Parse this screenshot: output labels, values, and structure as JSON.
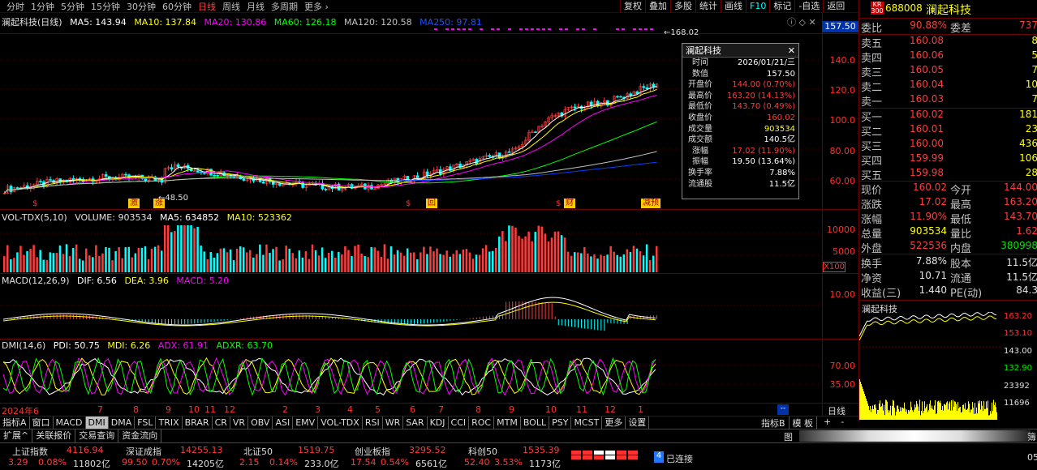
{
  "periods": [
    "分时",
    "1分钟",
    "5分钟",
    "15分钟",
    "30分钟",
    "60分钟",
    "日线",
    "周线",
    "月线",
    "多周期",
    "更多"
  ],
  "active_period": "日线",
  "toolbar": [
    "复权",
    "叠加",
    "多股",
    "统计",
    "画线",
    "F10",
    "标记",
    "-自选",
    "返回"
  ],
  "main_legend": {
    "name": "澜起科技(日线)",
    "ma5": "MA5: 143.94",
    "ma10": "MA10: 137.84",
    "ma20": "MA20: 130.86",
    "ma60": "MA60: 126.18",
    "ma120": "MA120: 120.58",
    "ma250": "MA250: 97.81"
  },
  "main_axis": [
    "140.0",
    "120.0",
    "100.0",
    "80.00",
    "60.00"
  ],
  "price_tag": "157.50",
  "high_mark": "168.02",
  "low_mark": "48.50",
  "markers": [
    "涨",
    "回",
    "财",
    "减预",
    "激",
    "涨"
  ],
  "vol_legend": {
    "name": "VOL-TDX(5,10)",
    "volume": "VOLUME: 903534",
    "ma5": "MA5: 634852",
    "ma10": "MA10: 523362"
  },
  "vol_axis": [
    "10000",
    "5000"
  ],
  "vol_unit": "X100",
  "macd_legend": {
    "name": "MACD(12,26,9)",
    "dif": "DIF: 6.56",
    "dea": "DEA: 3.96",
    "macd": "MACD: 5.20"
  },
  "macd_axis": [
    "10.00"
  ],
  "dmi_legend": {
    "name": "DMI(14,6)",
    "pdi": "PDI: 50.75",
    "mdi": "MDI: 6.26",
    "adx": "ADX: 61.91",
    "adxr": "ADXR: 63.70"
  },
  "dmi_axis": [
    "70.00",
    "35.00"
  ],
  "date_axis": [
    "2024年6",
    "7",
    "8",
    "9",
    "10",
    "11",
    "12",
    "2",
    "3",
    "4",
    "5",
    "6",
    "7",
    "8",
    "9",
    "10",
    "11",
    "12",
    "1"
  ],
  "date_right": "日线",
  "tooltip": {
    "title": "澜起科技",
    "rows": [
      [
        "时间",
        "2026/01/21/三"
      ],
      [
        "数值",
        "157.50"
      ],
      [
        "开盘价",
        "144.00 (0.70%)"
      ],
      [
        "最高价",
        "163.20 (14.13%)"
      ],
      [
        "最低价",
        "143.70 (0.49%)"
      ],
      [
        "收盘价",
        "160.02"
      ],
      [
        "成交量",
        "903534"
      ],
      [
        "成交额",
        "140.5亿"
      ],
      [
        "涨幅",
        "17.02 (11.90%)"
      ],
      [
        "振幅",
        "19.50 (13.64%)"
      ],
      [
        "换手率",
        "7.88%"
      ],
      [
        "流通股",
        "11.5亿"
      ]
    ]
  },
  "stock": {
    "badge": "KR",
    "badge_sub": "300",
    "code": "688008",
    "name": "澜起科技"
  },
  "webi": {
    "l": "委比",
    "v": "90.88%",
    "l2": "委差",
    "v2": "737"
  },
  "asks": [
    [
      "卖五",
      "160.08",
      "8"
    ],
    [
      "卖四",
      "160.06",
      "5"
    ],
    [
      "卖三",
      "160.05",
      "7"
    ],
    [
      "卖二",
      "160.04",
      "10"
    ],
    [
      "卖一",
      "160.03",
      "7"
    ]
  ],
  "bids": [
    [
      "买一",
      "160.02",
      "181"
    ],
    [
      "买二",
      "160.01",
      "23"
    ],
    [
      "买三",
      "160.00",
      "436"
    ],
    [
      "买四",
      "159.99",
      "106"
    ],
    [
      "买五",
      "159.98",
      "28"
    ]
  ],
  "quote": [
    [
      "现价",
      "160.02",
      "今开",
      "144.00"
    ],
    [
      "涨跌",
      "17.02",
      "最高",
      "163.20"
    ],
    [
      "涨幅",
      "11.90%",
      "最低",
      "143.70"
    ],
    [
      "总量",
      "903534",
      "量比",
      "1.62"
    ],
    [
      "外盘",
      "522536",
      "内盘",
      "380998"
    ]
  ],
  "stats": [
    [
      "换手",
      "7.88%",
      "股本",
      "11.5亿"
    ],
    [
      "净资",
      "10.71",
      "流通",
      "11.5亿"
    ],
    [
      "收益(三)",
      "1.440",
      "PE(动)",
      "84.3"
    ]
  ],
  "mini": {
    "title": "澜起科技",
    "labels": [
      "163.20",
      "153.10",
      "143.00",
      "132.90",
      "23392",
      "11696"
    ]
  },
  "tabs": [
    "指标A",
    "窗口",
    "MACD",
    "DMI",
    "DMA",
    "FSL",
    "TRIX",
    "BRAR",
    "CR",
    "VR",
    "OBV",
    "ASI",
    "EMV",
    "VOL-TDX",
    "RSI",
    "WR",
    "SAR",
    "KDJ",
    "CCI",
    "ROC",
    "MTM",
    "BOLL",
    "PSY",
    "MCST",
    "更多",
    "设置"
  ],
  "active_tab": "DMI",
  "tabs_right": [
    "指标B",
    "模 板",
    "+",
    "-"
  ],
  "row2": [
    "扩展^",
    "关联报价",
    "交易查询",
    "资金流向"
  ],
  "row2_right": "图",
  "row2_far": "簿",
  "indices": [
    {
      "name": "上证指数",
      "val": "4116.94",
      "chg": "3.29",
      "pct": "0.08%",
      "amt": "11802亿"
    },
    {
      "name": "深证成指",
      "val": "14255.13",
      "chg": "99.50",
      "pct": "0.70%",
      "amt": "14205亿"
    },
    {
      "name": "北证50",
      "val": "1519.75",
      "chg": "2.15",
      "pct": "0.14%",
      "amt": "233.0亿"
    },
    {
      "name": "创业板指",
      "val": "3295.52",
      "chg": "17.54",
      "pct": "0.54%",
      "amt": "6561亿"
    },
    {
      "name": "科创50",
      "val": "1535.39",
      "chg": "52.40",
      "pct": "3.53%",
      "amt": "1173亿"
    }
  ],
  "conn": "已连接",
  "conn_num": "4",
  "time_tail": "05",
  "colors": {
    "up": "#ff3c3c",
    "down": "#00e600",
    "ma5": "#ffffff",
    "ma10": "#ffff00",
    "ma20": "#ff00ff",
    "ma60": "#00ff00",
    "ma120": "#c0c0c0",
    "ma250": "#0040ff"
  }
}
